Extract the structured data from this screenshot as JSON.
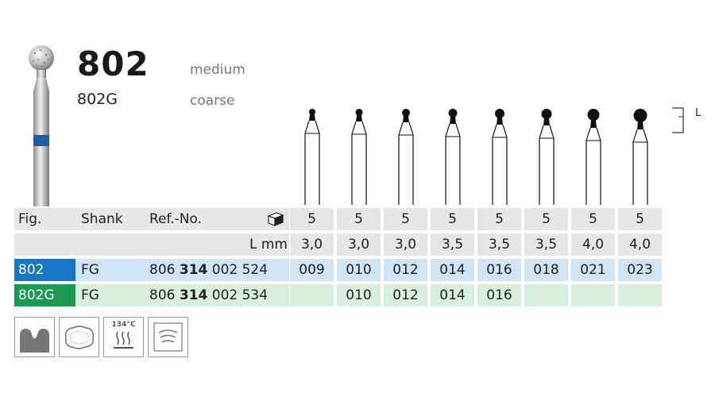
{
  "header": {
    "model": "802",
    "variant": "802G",
    "grit_primary": "medium",
    "grit_secondary": "coarse",
    "length_marker": "L"
  },
  "table": {
    "head": {
      "fig": "Fig.",
      "shank": "Shank",
      "ref": "Ref.-No."
    },
    "length_label": "L mm",
    "columns": [
      {
        "pack": "5",
        "length": "3,0"
      },
      {
        "pack": "5",
        "length": "3,0"
      },
      {
        "pack": "5",
        "length": "3,0"
      },
      {
        "pack": "5",
        "length": "3,5"
      },
      {
        "pack": "5",
        "length": "3,5"
      },
      {
        "pack": "5",
        "length": "3,5"
      },
      {
        "pack": "5",
        "length": "4,0"
      },
      {
        "pack": "5",
        "length": "4,0"
      }
    ],
    "rows": [
      {
        "fig": "802",
        "shank": "FG",
        "ref_prefix": "806",
        "ref_bold": "314",
        "ref_suffix": "002 524",
        "sizes": [
          "009",
          "010",
          "012",
          "014",
          "016",
          "018",
          "021",
          "023"
        ]
      },
      {
        "fig": "802G",
        "shank": "FG",
        "ref_prefix": "806",
        "ref_bold": "314",
        "ref_suffix": "002 534",
        "sizes": [
          "",
          "010",
          "012",
          "014",
          "016",
          "",
          "",
          ""
        ]
      }
    ]
  },
  "icons": {
    "temperature_label": "134°C",
    "items": [
      "tooth-icon",
      "prep-outline-icon",
      "sterilization-icon",
      "ultrasonic-icon"
    ]
  },
  "colors": {
    "medium_blue": "#1677c4",
    "coarse_green": "#1d9a52",
    "row_blue": "#cfe4f5",
    "row_green": "#d9eedd",
    "row_grey": "#e6e6e6"
  }
}
